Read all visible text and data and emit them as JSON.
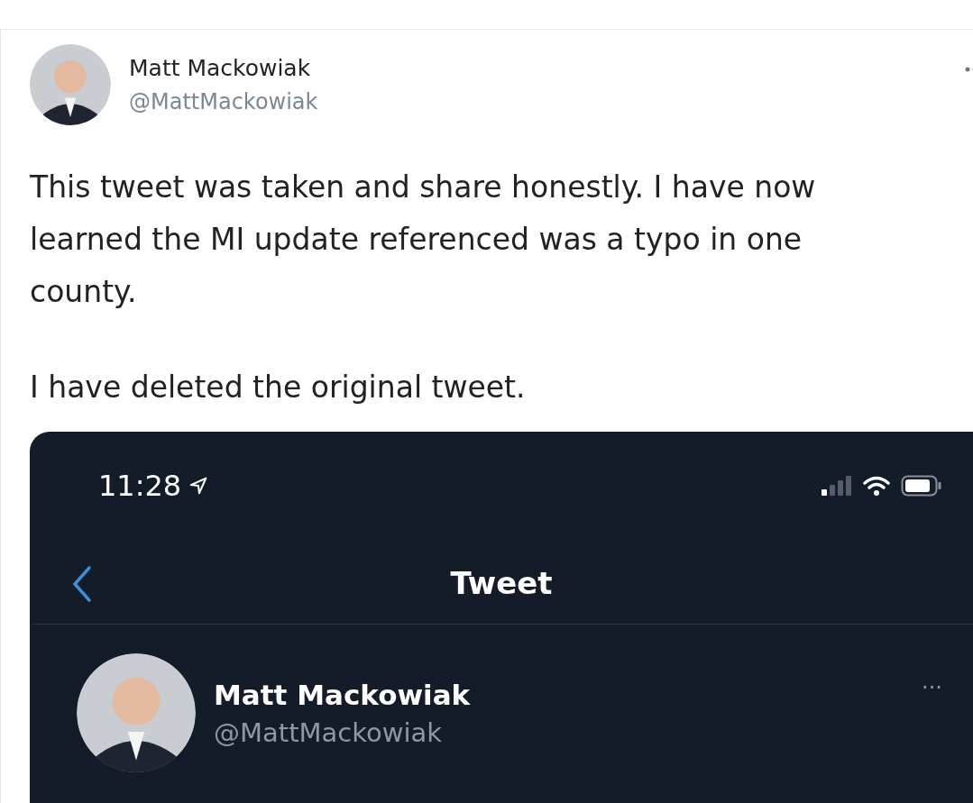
{
  "tweet": {
    "author": {
      "name": "Matt Mackowiak",
      "handle": "@MattMackowiak"
    },
    "paragraphs": [
      [
        "This tweet was taken and share honestly. I have now",
        "learned the MI update referenced was a typo in one",
        "county."
      ],
      [
        "I have deleted the original tweet."
      ]
    ],
    "embedded_screenshot": {
      "status_bar": {
        "time": "11:28"
      },
      "header": {
        "title": "Tweet"
      },
      "author": {
        "name": "Matt Mackowiak",
        "handle": "@MattMackowiak"
      },
      "more_menu": "···"
    }
  }
}
